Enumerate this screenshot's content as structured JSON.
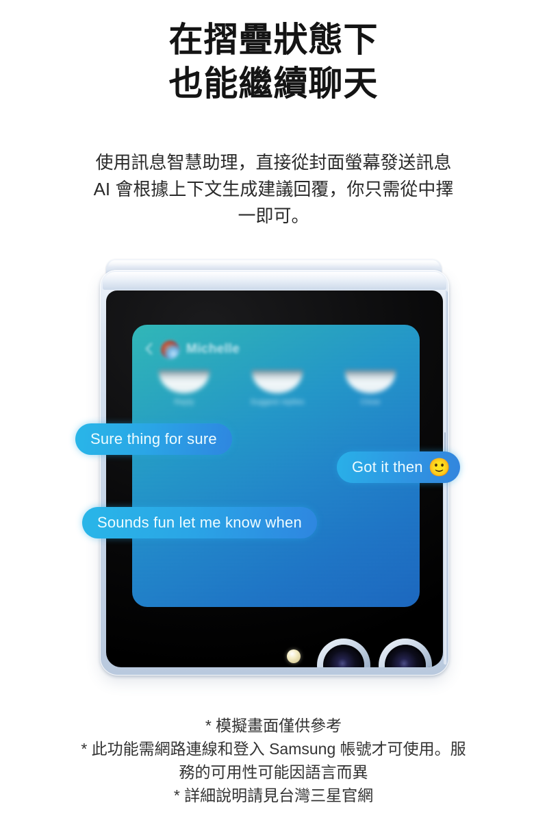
{
  "headline": {
    "line1": "在摺疊狀態下",
    "line2": "也能繼續聊天"
  },
  "body": {
    "line1": "使用訊息智慧助理，直接從封面螢幕發送訊息",
    "line2": "AI 會根據上下文生成建議回覆，你只需從中擇",
    "line3": "一即可。"
  },
  "phone": {
    "cover_screen": {
      "header": {
        "back_icon": "back-chevron-icon",
        "avatar": "contact-avatar",
        "contact_name": "Michelle"
      },
      "suggestions": [
        {
          "label": "Reply"
        },
        {
          "label": "Suggest replies"
        },
        {
          "label": "Close"
        }
      ]
    },
    "camera": {
      "flash": "flash-led",
      "lens_1": "camera-lens-wide",
      "lens_2": "camera-lens-ultrawide"
    }
  },
  "bubbles": [
    {
      "text": "Sure thing for sure",
      "emoji": ""
    },
    {
      "text": "Got it then",
      "emoji": "🙂"
    },
    {
      "text": "Sounds fun let me know when",
      "emoji": ""
    }
  ],
  "footnotes": {
    "line1": "* 模擬畫面僅供參考",
    "line2": "* 此功能需網路連線和登入 Samsung 帳號才可使用。服",
    "line3": "務的可用性可能因語言而異",
    "line4": "* 詳細說明請見台灣三星官網"
  },
  "colors": {
    "background": "#ffffff",
    "text": "#141414",
    "bubble_accent": "#2aa6e6",
    "screen_teal": "#2fb7b8",
    "screen_blue": "#1a66bf",
    "frame": "#c8d6e8"
  }
}
